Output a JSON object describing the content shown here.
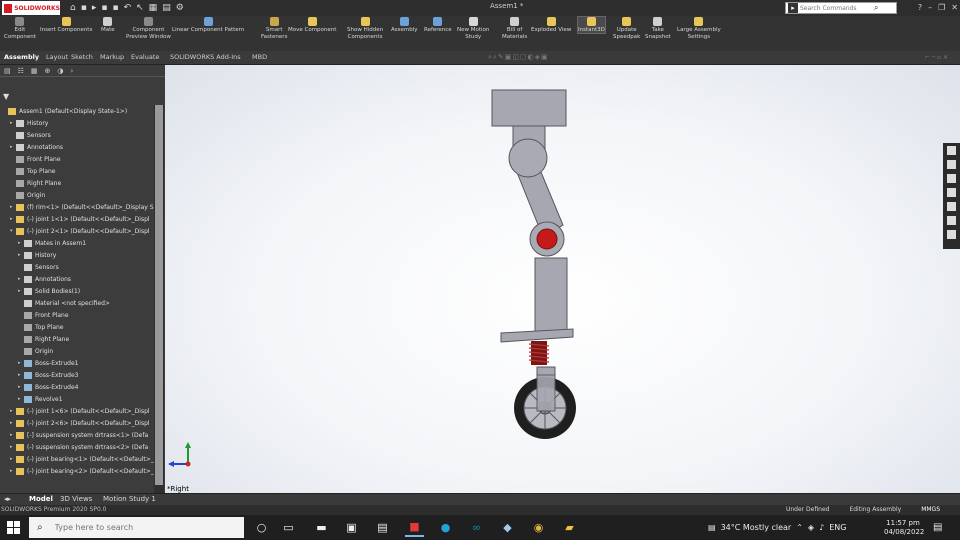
{
  "titlebar": {
    "app_brand": "SOLIDWORKS",
    "document_title": "Assem1 *",
    "search_placeholder": "Search Commands"
  },
  "ribbon": {
    "buttons": [
      {
        "label": "Edit",
        "label2": "Component"
      },
      {
        "label": "Insert Components",
        "label2": ""
      },
      {
        "label": "Mate",
        "label2": ""
      },
      {
        "label": "Component",
        "label2": "Preview Window"
      },
      {
        "label": "Linear Component Pattern",
        "label2": ""
      },
      {
        "label": "Smart",
        "label2": "Fasteners"
      },
      {
        "label": "Move Component",
        "label2": ""
      },
      {
        "label": "Show Hidden",
        "label2": "Components"
      },
      {
        "label": "Assembly",
        "label2": ""
      },
      {
        "label": "Reference",
        "label2": ""
      },
      {
        "label": "New Motion",
        "label2": "Study"
      },
      {
        "label": "Bill of",
        "label2": "Materials"
      },
      {
        "label": "Exploded View",
        "label2": ""
      },
      {
        "label": "Instant3D",
        "label2": ""
      },
      {
        "label": "Update",
        "label2": "Speedpak"
      },
      {
        "label": "Take",
        "label2": "Snapshot"
      },
      {
        "label": "Large Assembly",
        "label2": "Settings"
      }
    ]
  },
  "command_tabs": [
    "Assembly",
    "Layout",
    "Sketch",
    "Markup",
    "Evaluate",
    "SOLIDWORKS Add-Ins",
    "MBD"
  ],
  "tree": {
    "nodes": [
      {
        "label": "Assem1 (Default<Display State-1>)",
        "indent": 0,
        "exp": "",
        "color": "#e8c35a"
      },
      {
        "label": "History",
        "indent": 1,
        "exp": "▸",
        "color": "#cfcfcf"
      },
      {
        "label": "Sensors",
        "indent": 1,
        "exp": "",
        "color": "#cfcfcf"
      },
      {
        "label": "Annotations",
        "indent": 1,
        "exp": "▸",
        "color": "#cfcfcf"
      },
      {
        "label": "Front Plane",
        "indent": 1,
        "exp": "",
        "color": "#a8a8a8"
      },
      {
        "label": "Top Plane",
        "indent": 1,
        "exp": "",
        "color": "#a8a8a8"
      },
      {
        "label": "Right Plane",
        "indent": 1,
        "exp": "",
        "color": "#a8a8a8"
      },
      {
        "label": "Origin",
        "indent": 1,
        "exp": "",
        "color": "#a8a8a8"
      },
      {
        "label": "(f) rim<1> (Default<<Default>_Display S",
        "indent": 1,
        "exp": "▸",
        "color": "#e8c35a"
      },
      {
        "label": "(-) joint 1<1> (Default<<Default>_Displ",
        "indent": 1,
        "exp": "▸",
        "color": "#e8c35a"
      },
      {
        "label": "(-) joint 2<1> (Default<<Default>_Displ",
        "indent": 1,
        "exp": "▾",
        "color": "#e8c35a"
      },
      {
        "label": "Mates in Assem1",
        "indent": 2,
        "exp": "▸",
        "color": "#cfcfcf"
      },
      {
        "label": "History",
        "indent": 2,
        "exp": "▸",
        "color": "#cfcfcf"
      },
      {
        "label": "Sensors",
        "indent": 2,
        "exp": "",
        "color": "#cfcfcf"
      },
      {
        "label": "Annotations",
        "indent": 2,
        "exp": "▸",
        "color": "#cfcfcf"
      },
      {
        "label": "Solid Bodies(1)",
        "indent": 2,
        "exp": "▸",
        "color": "#cfcfcf"
      },
      {
        "label": "Material <not specified>",
        "indent": 2,
        "exp": "",
        "color": "#cfcfcf"
      },
      {
        "label": "Front Plane",
        "indent": 2,
        "exp": "",
        "color": "#a8a8a8"
      },
      {
        "label": "Top Plane",
        "indent": 2,
        "exp": "",
        "color": "#a8a8a8"
      },
      {
        "label": "Right Plane",
        "indent": 2,
        "exp": "",
        "color": "#a8a8a8"
      },
      {
        "label": "Origin",
        "indent": 2,
        "exp": "",
        "color": "#a8a8a8"
      },
      {
        "label": "Boss-Extrude1",
        "indent": 2,
        "exp": "▸",
        "color": "#8fb8d8"
      },
      {
        "label": "Boss-Extrude3",
        "indent": 2,
        "exp": "▸",
        "color": "#8fb8d8"
      },
      {
        "label": "Boss-Extrude4",
        "indent": 2,
        "exp": "▸",
        "color": "#8fb8d8"
      },
      {
        "label": "Revolve1",
        "indent": 2,
        "exp": "▸",
        "color": "#8fb8d8"
      },
      {
        "label": "(-) joint 1<6> (Default<<Default>_Displ",
        "indent": 1,
        "exp": "▸",
        "color": "#e8c35a"
      },
      {
        "label": "(-) joint 2<6> (Default<<Default>_Displ",
        "indent": 1,
        "exp": "▸",
        "color": "#e8c35a"
      },
      {
        "label": "[-] suspension system drtrass<1> (Defa",
        "indent": 1,
        "exp": "▸",
        "color": "#e8c35a"
      },
      {
        "label": "(-) suspension system drtrass<2> (Defa",
        "indent": 1,
        "exp": "▸",
        "color": "#e8c35a"
      },
      {
        "label": "(-) joint bearing<1> (Default<<Default>_",
        "indent": 1,
        "exp": "▸",
        "color": "#e8c35a"
      },
      {
        "label": "(-) joint bearing<2> (Default<<Default>_",
        "indent": 1,
        "exp": "▸",
        "color": "#e8c35a"
      }
    ]
  },
  "graphics": {
    "view_label": "*Right"
  },
  "bottom_tabs": [
    "Model",
    "3D Views",
    "Motion Study 1"
  ],
  "statusbar": {
    "left": "SOLIDWORKS Premium 2020 SP0.0",
    "state": "Under Defined",
    "mode": "Editing Assembly",
    "units": "MMGS"
  },
  "taskbar": {
    "search_placeholder": "Type here to search",
    "weather": "34°C  Mostly clear",
    "language": "ENG",
    "time": "11:57 pm",
    "date": "04/08/2022"
  },
  "colors": {
    "part_gray": "#a6a7b1",
    "bearing_red": "#c41a1a",
    "spring_red": "#7e1515",
    "tire_black": "#1f1f1f"
  }
}
